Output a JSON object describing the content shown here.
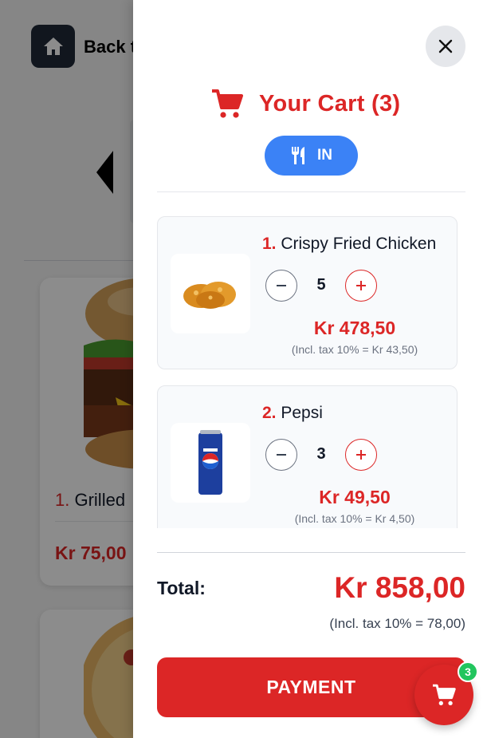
{
  "background": {
    "back_label": "Back t",
    "products": [
      {
        "number": "1.",
        "name": "Grilled",
        "price": "Kr 75,00"
      }
    ]
  },
  "cart": {
    "title": "Your Cart (3)",
    "mode_label": "IN",
    "items": [
      {
        "number": "1.",
        "name": "Crispy Fried Chicken",
        "quantity": "5",
        "price": "Kr 478,50",
        "tax_note": "(Incl. tax 10% = Kr 43,50)"
      },
      {
        "number": "2.",
        "name": "Pepsi",
        "quantity": "3",
        "price": "Kr 49,50",
        "tax_note": "(Incl. tax 10% = Kr 4,50)"
      }
    ],
    "total_label": "Total:",
    "total_value": "Kr 858,00",
    "total_tax_note": "(Incl. tax 10% = 78,00)",
    "payment_label": "PAYMENT"
  },
  "floating_cart": {
    "badge_count": "3"
  },
  "icons": {
    "home": "home-icon",
    "close": "close-icon",
    "cart": "shopping-cart-icon",
    "dine_in": "fork-knife-icon",
    "minus": "minus-icon",
    "plus": "plus-icon"
  },
  "colors": {
    "accent": "#dc2626",
    "mode_button": "#3b82f6",
    "badge": "#22c55e",
    "back_button": "#1f2937"
  }
}
